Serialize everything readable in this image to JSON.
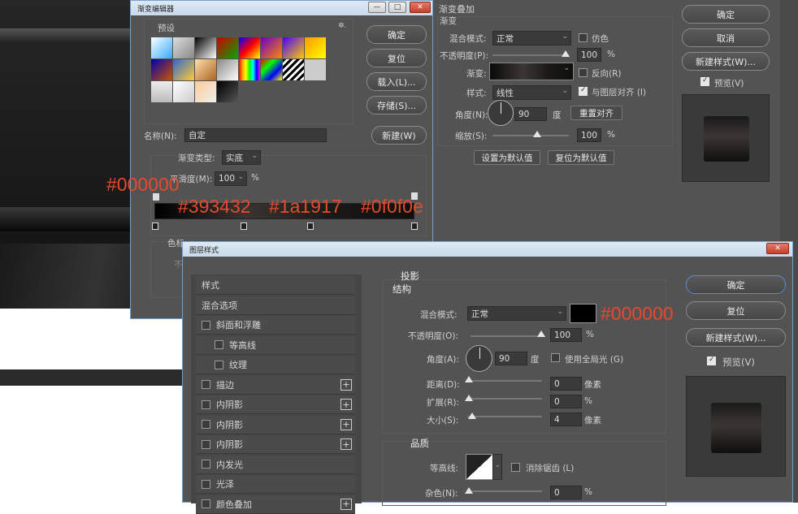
{
  "gradient_editor": {
    "title": "渐变编辑器",
    "presets_label": "预设",
    "gear": "✲.",
    "ok": "确定",
    "reset": "复位",
    "load": "载入(L)...",
    "save": "存储(S)...",
    "name_label": "名称(N):",
    "name_value": "自定",
    "new": "新建(W)",
    "type_label": "渐变类型:",
    "type_value": "实底",
    "smooth_label": "平滑度(M):",
    "smooth_value": "100",
    "percent": "%",
    "stops_label": "色标",
    "stops_sub": "不",
    "win_min": "—",
    "win_max": "□",
    "win_close": "✕"
  },
  "gradient_overlay": {
    "title": "渐变叠加",
    "section": "渐变",
    "blend_label": "混合模式:",
    "blend_value": "正常",
    "dither_label": "仿色",
    "opacity_label": "不透明度(P):",
    "opacity_value": "100",
    "gradient_label": "渐变:",
    "reverse_label": "反向(R)",
    "style_label": "样式:",
    "style_value": "线性",
    "align_label": "与图层对齐 (I)",
    "angle_label": "角度(N):",
    "angle_value": "90",
    "degree": "度",
    "reset_align": "重置对齐",
    "scale_label": "缩放(S):",
    "scale_value": "100",
    "percent": "%",
    "set_default": "设置为默认值",
    "reset_default": "复位为默认值",
    "ok": "确定",
    "cancel": "取消",
    "new_style": "新建样式(W)...",
    "preview_label": "预览(V)"
  },
  "layer_style": {
    "title": "图层样式",
    "left_list": [
      {
        "label": "样式",
        "checkbox": false,
        "plus": false,
        "indent": false
      },
      {
        "label": "混合选项",
        "checkbox": false,
        "plus": false,
        "indent": false
      },
      {
        "label": "斜面和浮雕",
        "checkbox": true,
        "plus": false,
        "indent": false
      },
      {
        "label": "等高线",
        "checkbox": true,
        "plus": false,
        "indent": true
      },
      {
        "label": "纹理",
        "checkbox": true,
        "plus": false,
        "indent": true
      },
      {
        "label": "描边",
        "checkbox": true,
        "plus": true,
        "indent": false
      },
      {
        "label": "内阴影",
        "checkbox": true,
        "plus": true,
        "indent": false
      },
      {
        "label": "内阴影",
        "checkbox": true,
        "plus": true,
        "indent": false
      },
      {
        "label": "内阴影",
        "checkbox": true,
        "plus": true,
        "indent": false
      },
      {
        "label": "内发光",
        "checkbox": true,
        "plus": false,
        "indent": false
      },
      {
        "label": "光泽",
        "checkbox": true,
        "plus": false,
        "indent": false
      },
      {
        "label": "颜色叠加",
        "checkbox": true,
        "plus": true,
        "indent": false
      }
    ],
    "plus_glyph": "+",
    "section": "投影",
    "structure": "结构",
    "blend_label": "混合模式:",
    "blend_value": "正常",
    "opacity_label": "不透明度(O):",
    "opacity_value": "100",
    "angle_label": "角度(A):",
    "angle_value": "90",
    "degree": "度",
    "global_light": "使用全局光 (G)",
    "distance_label": "距离(D):",
    "distance_value": "0",
    "spread_label": "扩展(R):",
    "spread_value": "0",
    "size_label": "大小(S):",
    "size_value": "4",
    "pixel": "像素",
    "percent": "%",
    "quality": "品质",
    "contour_label": "等高线:",
    "antialias": "消除锯齿 (L)",
    "noise_label": "杂色(N):",
    "noise_value": "0",
    "ok": "确定",
    "reset": "复位",
    "new_style": "新建样式(W)...",
    "preview_label": "预览(V)",
    "win_close": "✕"
  },
  "annotations": {
    "stop1": "#000000",
    "stop2": "#393432",
    "stop3": "#1a1917",
    "stop4": "#0f0f0e",
    "shadow_color": "#000000"
  },
  "colors": {
    "panel": "#535353",
    "accent_red": "#e64a2e",
    "titlebar": "#d4e3f2"
  }
}
